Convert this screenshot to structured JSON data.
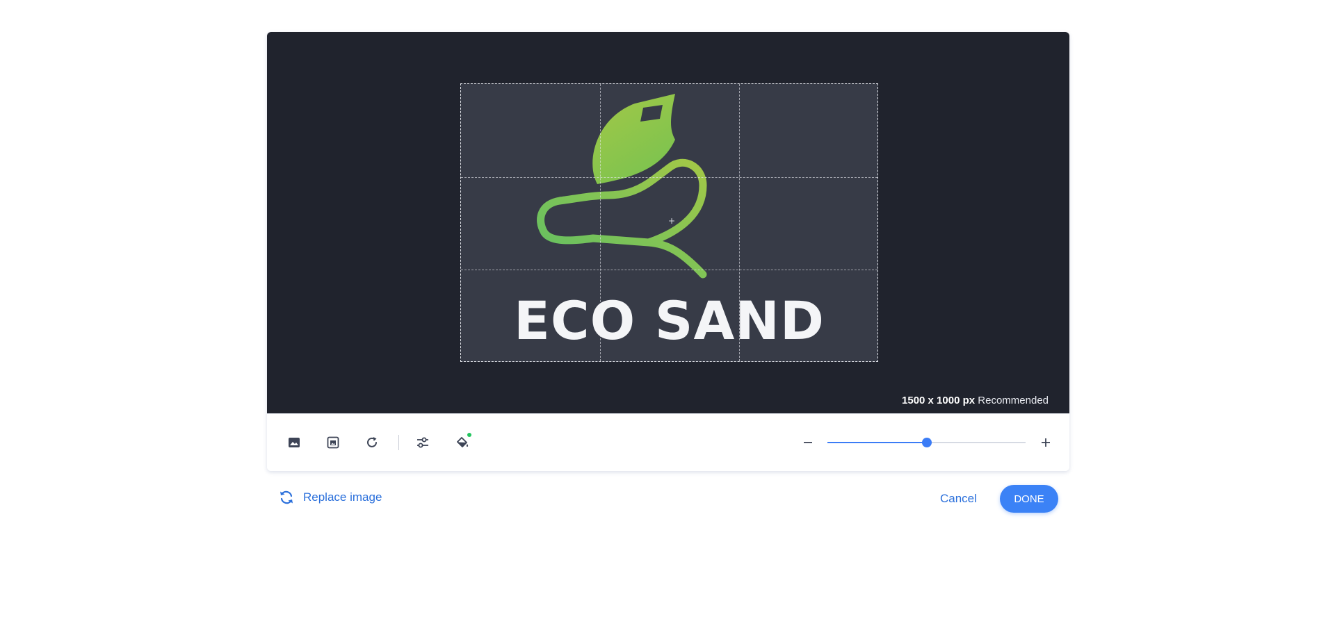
{
  "canvas": {
    "logo_text": "ECO SAND",
    "size_value": "1500 x 1000 px",
    "size_suffix": "Recommended",
    "center_mark": "+"
  },
  "toolbar": {
    "tools": [
      {
        "name": "image-icon"
      },
      {
        "name": "save-image-icon"
      },
      {
        "name": "rotate-icon"
      },
      {
        "name": "adjustments-icon"
      },
      {
        "name": "fill-bucket-icon"
      }
    ],
    "fill_status_color": "#22c55e",
    "zoom_level": 0.5
  },
  "footer": {
    "replace_label": "Replace image",
    "cancel_label": "Cancel",
    "done_label": "DONE"
  },
  "colors": {
    "accent": "#3b82f6",
    "link": "#2a6fdb",
    "canvas_bg": "#20232d",
    "frame_bg": "#373b47",
    "logo_gradient": [
      "#a3c847",
      "#5fbf64"
    ]
  }
}
